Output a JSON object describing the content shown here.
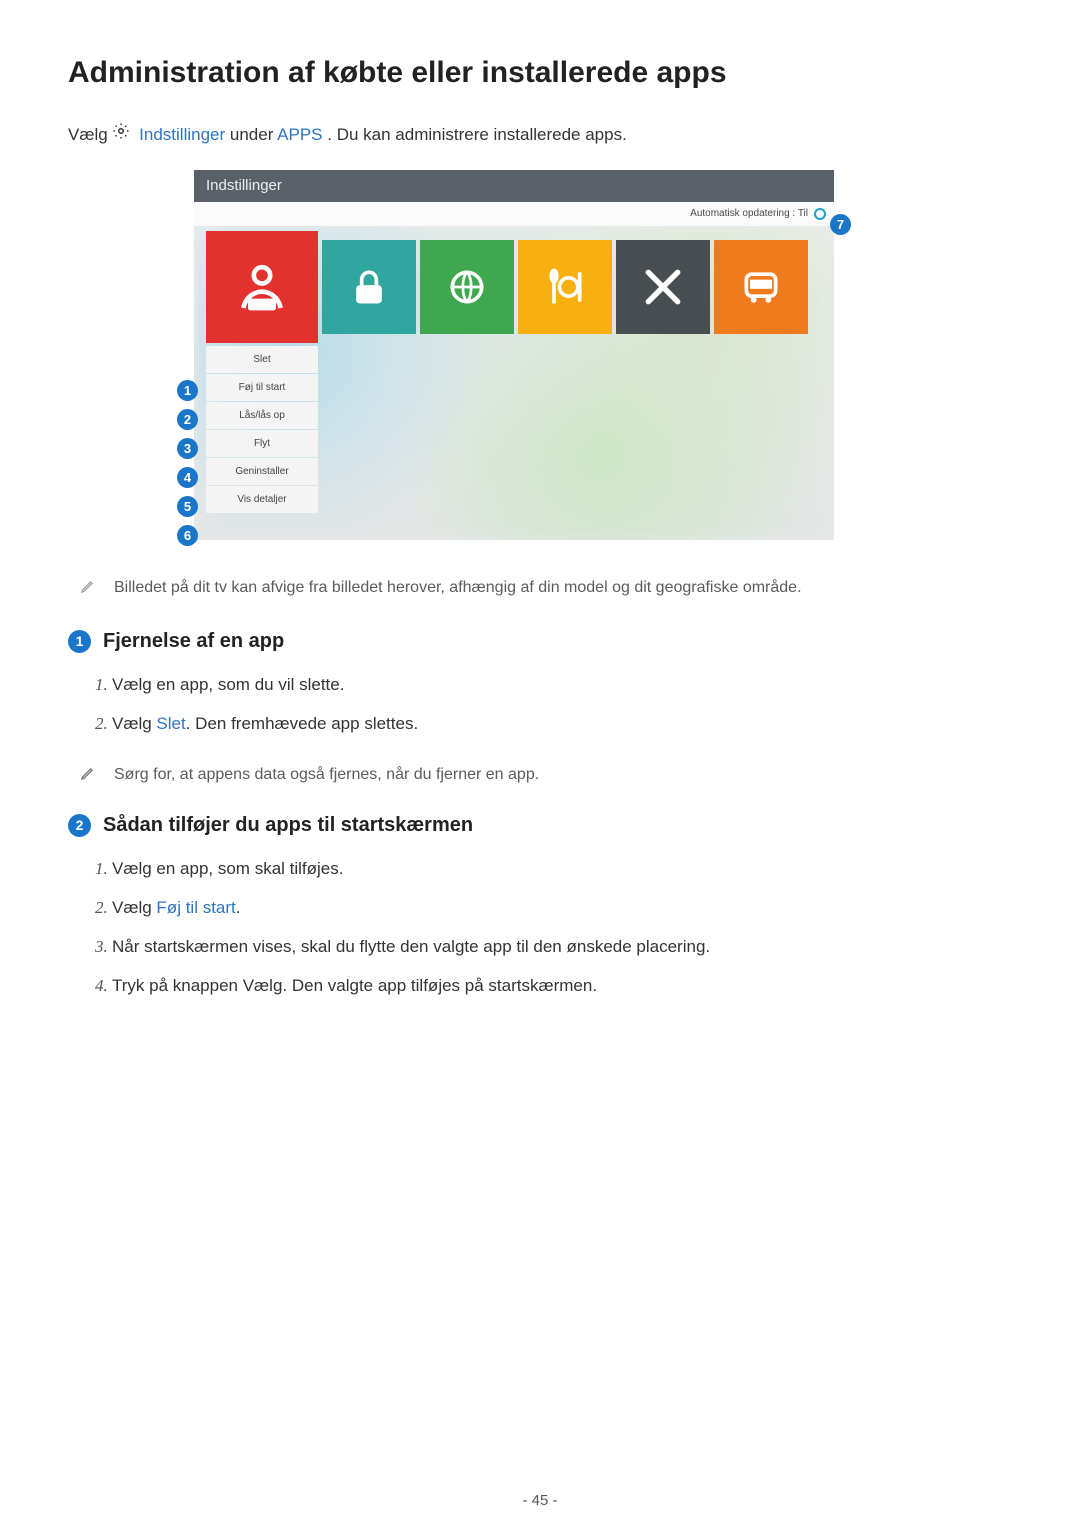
{
  "title": "Administration af købte eller installerede apps",
  "intro": {
    "prefix": "Vælg ",
    "link1": "Indstillinger",
    "mid": " under ",
    "link2": "APPS",
    "suffix": ". Du kan administrere installerede apps."
  },
  "screenshot": {
    "header": "Indstillinger",
    "auto_update_label": "Automatisk opdatering : Til",
    "tiles": [
      {
        "name": "app-tile-people",
        "color": "tile-red",
        "icon": "people"
      },
      {
        "name": "app-tile-lock",
        "color": "tile-teal",
        "icon": "lock"
      },
      {
        "name": "app-tile-globe",
        "color": "tile-green",
        "icon": "globe"
      },
      {
        "name": "app-tile-food",
        "color": "tile-yellow",
        "icon": "food"
      },
      {
        "name": "app-tile-tools",
        "color": "tile-grey",
        "icon": "tools"
      },
      {
        "name": "app-tile-bus",
        "color": "tile-orange",
        "icon": "bus"
      }
    ],
    "menu": [
      "Slet",
      "Føj til start",
      "Lås/lås op",
      "Flyt",
      "Geninstaller",
      "Vis detaljer"
    ],
    "callouts_left": [
      "1",
      "2",
      "3",
      "4",
      "5",
      "6"
    ],
    "callout_top_right": "7"
  },
  "note_image_vary": "Billedet på dit tv kan afvige fra billedet herover, afhængig af din model og dit geografiske område.",
  "sections": [
    {
      "num": "1",
      "heading": "Fjernelse af en app",
      "steps": [
        {
          "parts": [
            {
              "t": "Vælg en app, som du vil slette."
            }
          ]
        },
        {
          "parts": [
            {
              "t": "Vælg "
            },
            {
              "t": "Slet",
              "link": true
            },
            {
              "t": ". Den fremhævede app slettes."
            }
          ]
        }
      ],
      "note": "Sørg for, at appens data også fjernes, når du fjerner en app."
    },
    {
      "num": "2",
      "heading": "Sådan tilføjer du apps til startskærmen",
      "steps": [
        {
          "parts": [
            {
              "t": "Vælg en app, som skal tilføjes."
            }
          ]
        },
        {
          "parts": [
            {
              "t": "Vælg "
            },
            {
              "t": "Føj til start",
              "link": true
            },
            {
              "t": "."
            }
          ]
        },
        {
          "parts": [
            {
              "t": "Når startskærmen vises, skal du flytte den valgte app til den ønskede placering."
            }
          ]
        },
        {
          "parts": [
            {
              "t": "Tryk på knappen Vælg. Den valgte app tilføjes på startskærmen."
            }
          ]
        }
      ]
    }
  ],
  "page_number": "- 45 -"
}
